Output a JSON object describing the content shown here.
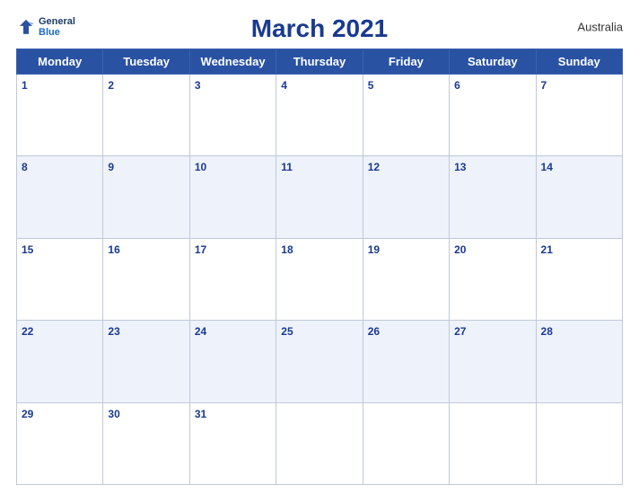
{
  "header": {
    "title": "March 2021",
    "country": "Australia",
    "logo": {
      "line1": "General",
      "line2": "Blue"
    }
  },
  "days_of_week": [
    "Monday",
    "Tuesday",
    "Wednesday",
    "Thursday",
    "Friday",
    "Saturday",
    "Sunday"
  ],
  "weeks": [
    [
      {
        "num": "1",
        "empty": false
      },
      {
        "num": "2",
        "empty": false
      },
      {
        "num": "3",
        "empty": false
      },
      {
        "num": "4",
        "empty": false
      },
      {
        "num": "5",
        "empty": false
      },
      {
        "num": "6",
        "empty": false
      },
      {
        "num": "7",
        "empty": false
      }
    ],
    [
      {
        "num": "8",
        "empty": false
      },
      {
        "num": "9",
        "empty": false
      },
      {
        "num": "10",
        "empty": false
      },
      {
        "num": "11",
        "empty": false
      },
      {
        "num": "12",
        "empty": false
      },
      {
        "num": "13",
        "empty": false
      },
      {
        "num": "14",
        "empty": false
      }
    ],
    [
      {
        "num": "15",
        "empty": false
      },
      {
        "num": "16",
        "empty": false
      },
      {
        "num": "17",
        "empty": false
      },
      {
        "num": "18",
        "empty": false
      },
      {
        "num": "19",
        "empty": false
      },
      {
        "num": "20",
        "empty": false
      },
      {
        "num": "21",
        "empty": false
      }
    ],
    [
      {
        "num": "22",
        "empty": false
      },
      {
        "num": "23",
        "empty": false
      },
      {
        "num": "24",
        "empty": false
      },
      {
        "num": "25",
        "empty": false
      },
      {
        "num": "26",
        "empty": false
      },
      {
        "num": "27",
        "empty": false
      },
      {
        "num": "28",
        "empty": false
      }
    ],
    [
      {
        "num": "29",
        "empty": false
      },
      {
        "num": "30",
        "empty": false
      },
      {
        "num": "31",
        "empty": false
      },
      {
        "num": "",
        "empty": true
      },
      {
        "num": "",
        "empty": true
      },
      {
        "num": "",
        "empty": true
      },
      {
        "num": "",
        "empty": true
      }
    ]
  ],
  "colors": {
    "header_bg": "#2952a3",
    "day_num": "#1a3a8f",
    "row_even_bg": "#eef2fa",
    "border": "#c0c8d8"
  }
}
